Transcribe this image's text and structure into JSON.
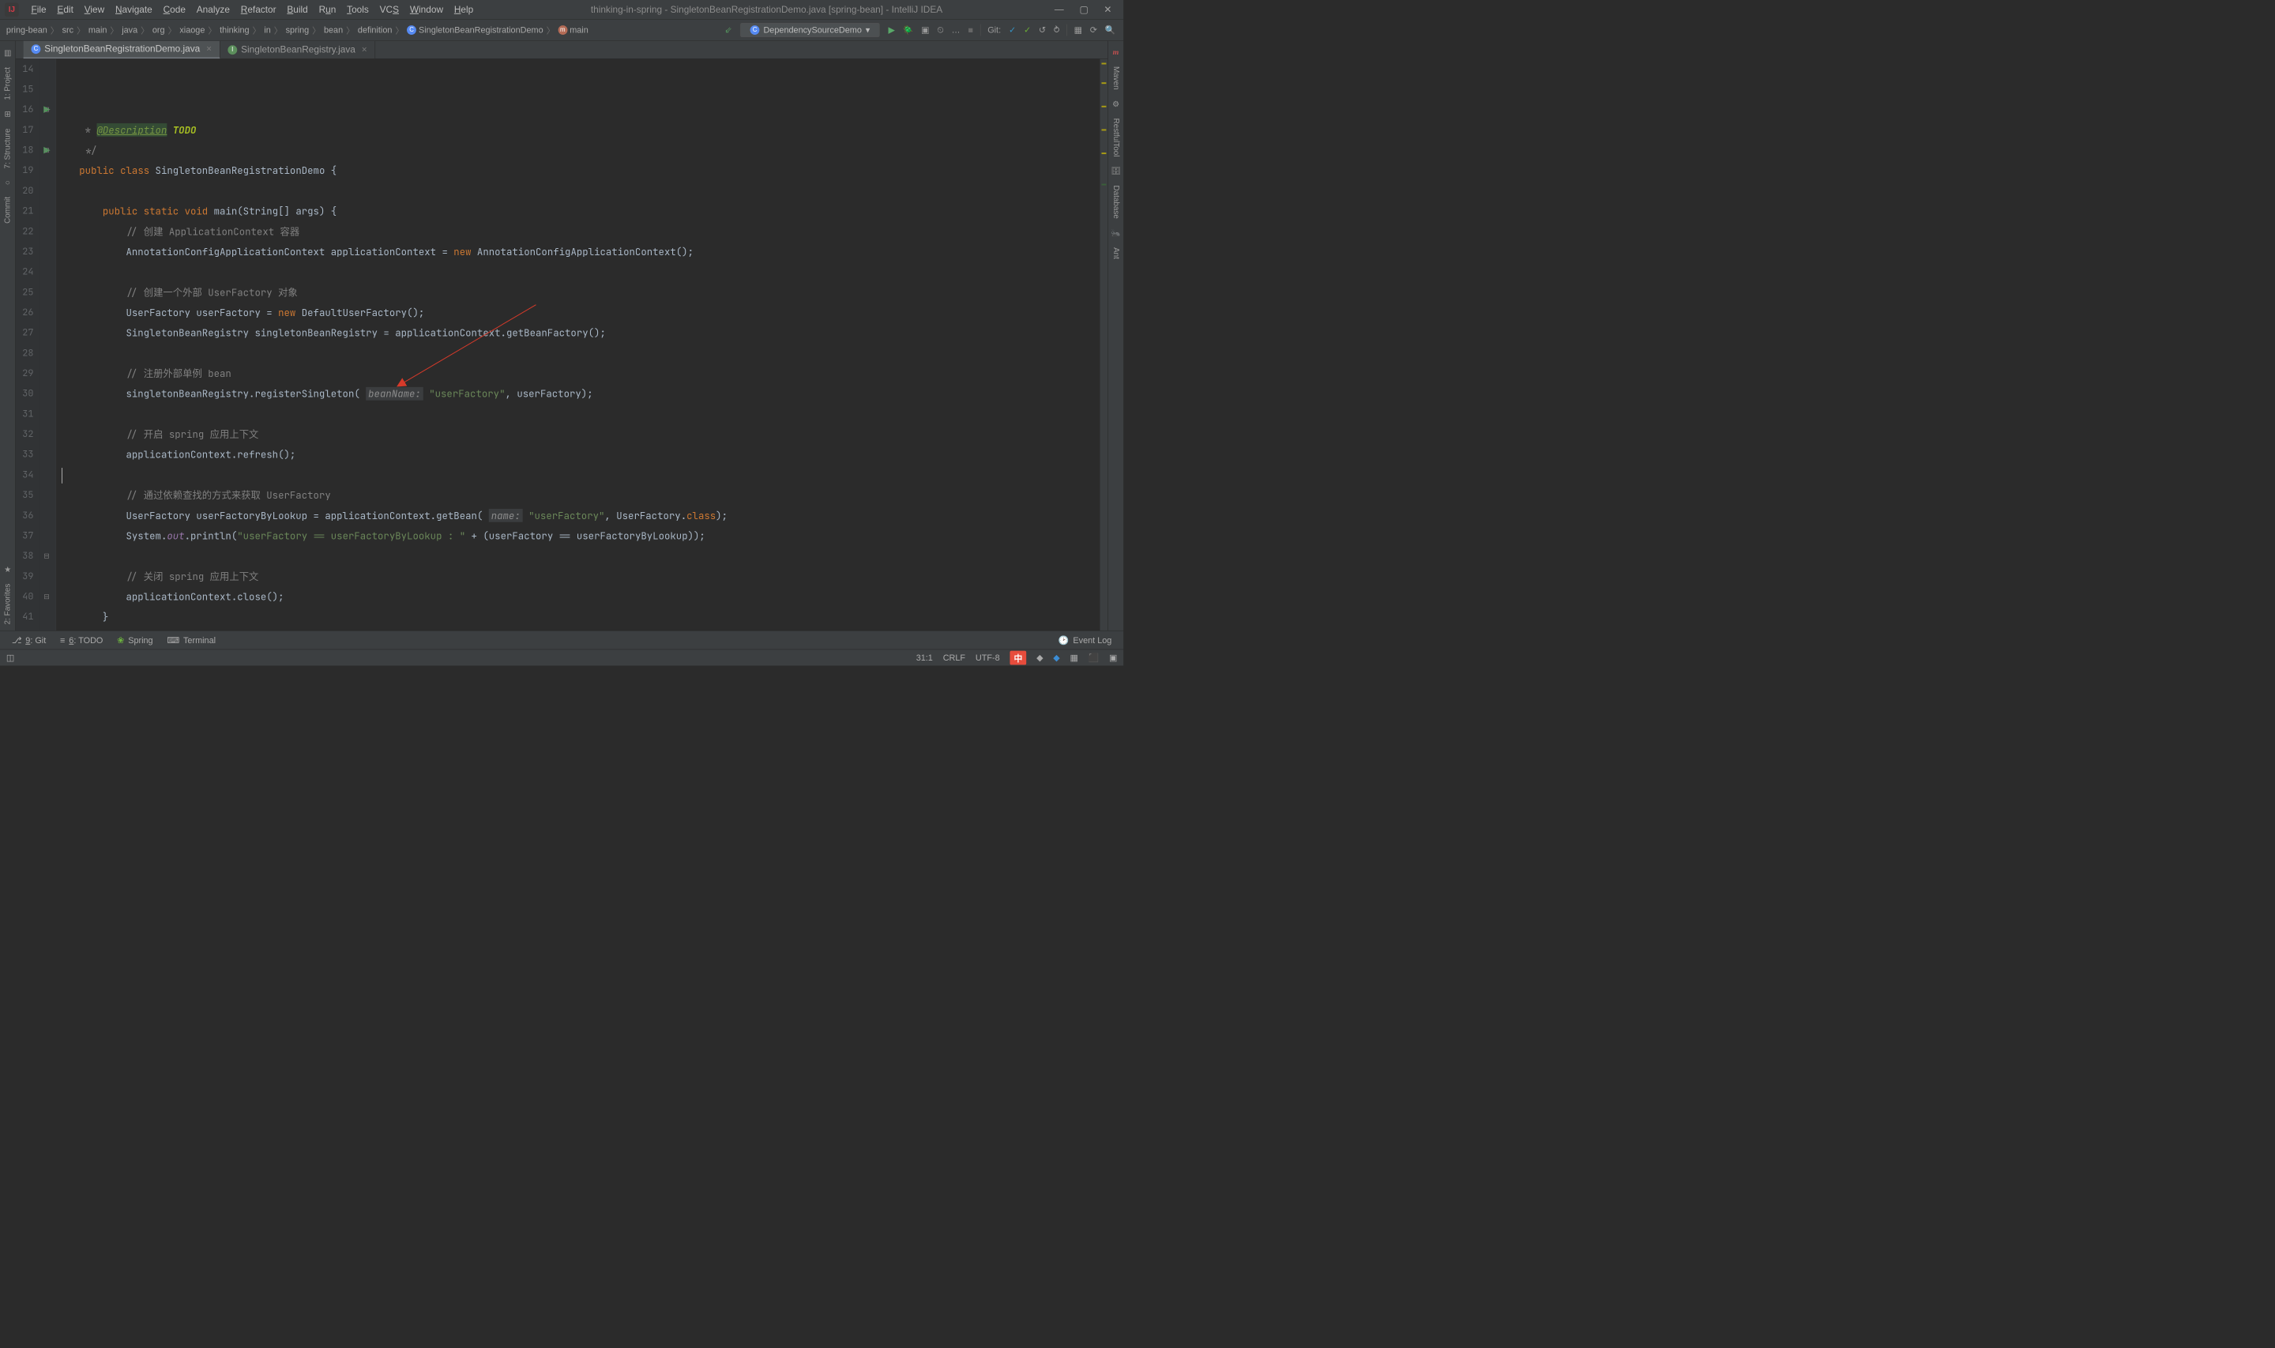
{
  "window": {
    "title": "thinking-in-spring - SingletonBeanRegistrationDemo.java [spring-bean] - IntelliJ IDEA"
  },
  "menu": {
    "file": "File",
    "edit": "Edit",
    "view": "View",
    "navigate": "Navigate",
    "code": "Code",
    "analyze": "Analyze",
    "refactor": "Refactor",
    "build": "Build",
    "run": "Run",
    "tools": "Tools",
    "vcs": "VCS",
    "window": "Window",
    "help": "Help"
  },
  "breadcrumb": [
    "pring-bean",
    "src",
    "main",
    "java",
    "org",
    "xiaoge",
    "thinking",
    "in",
    "spring",
    "bean",
    "definition",
    "SingletonBeanRegistrationDemo",
    "main"
  ],
  "runconfig": {
    "label": "DependencySourceDemo"
  },
  "git_label": "Git:",
  "tabs": {
    "t1": "SingletonBeanRegistrationDemo.java",
    "t2": "SingletonBeanRegistry.java"
  },
  "left_rail": {
    "project": "1: Project",
    "structure": "7: Structure",
    "commit": "Commit",
    "favorites": "2: Favorites"
  },
  "right_rail": {
    "maven": "Maven",
    "restful": "RestfulTool",
    "database": "Database",
    "ant": "Ant"
  },
  "code": {
    "line_start": 14,
    "cursor_line": 31,
    "lines": [
      {
        "n": 14,
        "html": "    <span class='comm'>* </span><span class='ann'>@Description</span><span class='todo'> TODO</span>"
      },
      {
        "n": 15,
        "html": "    <span class='comm'>*/</span>"
      },
      {
        "n": 16,
        "run": true,
        "fold": true,
        "html": "   <span class='kw'>public class</span> SingletonBeanRegistrationDemo {"
      },
      {
        "n": 17,
        "html": ""
      },
      {
        "n": 18,
        "run": true,
        "fold": true,
        "html": "       <span class='kw'>public static void</span> <span class='meth'>main</span>(String[] args) {"
      },
      {
        "n": 19,
        "html": "           <span class='comm'>// 创建 ApplicationContext 容器</span>"
      },
      {
        "n": 20,
        "html": "           AnnotationConfigApplicationContext applicationContext = <span class='kw'>new</span> AnnotationConfigApplicationContext();"
      },
      {
        "n": 21,
        "html": ""
      },
      {
        "n": 22,
        "html": "           <span class='comm'>// 创建一个外部 UserFactory 对象</span>"
      },
      {
        "n": 23,
        "html": "           UserFactory userFactory = <span class='kw'>new</span> DefaultUserFactory();"
      },
      {
        "n": 24,
        "html": "           SingletonBeanRegistry singletonBeanRegistry = applicationContext.getBeanFactory();"
      },
      {
        "n": 25,
        "html": ""
      },
      {
        "n": 26,
        "html": "           <span class='comm'>// 注册外部单例 bean</span>"
      },
      {
        "n": 27,
        "html": "           singletonBeanRegistry.registerSingleton( <span class='paramname'>beanName:</span> <span class='str'>\"userFactory\"</span>, userFactory);"
      },
      {
        "n": 28,
        "html": ""
      },
      {
        "n": 29,
        "html": "           <span class='comm'>// 开启 spring 应用上下文</span>"
      },
      {
        "n": 30,
        "html": "           applicationContext.refresh();"
      },
      {
        "n": 31,
        "html": "<span class='caret'></span>"
      },
      {
        "n": 32,
        "html": "           <span class='comm'>// 通过依赖查找的方式来获取 UserFactory</span>"
      },
      {
        "n": 33,
        "html": "           UserFactory userFactoryByLookup = applicationContext.getBean( <span class='paramname'>name:</span> <span class='str'>\"userFactory\"</span>, UserFactory.<span class='kw'>class</span>);"
      },
      {
        "n": 34,
        "html": "           System.<span class='field'>out</span>.println(<span class='str'>\"userFactory == userFactoryByLookup : \"</span> + (userFactory == userFactoryByLookup));"
      },
      {
        "n": 35,
        "html": ""
      },
      {
        "n": 36,
        "html": "           <span class='comm'>// 关闭 spring 应用上下文</span>"
      },
      {
        "n": 37,
        "html": "           applicationContext.close();"
      },
      {
        "n": 38,
        "fold": true,
        "html": "       }"
      },
      {
        "n": 39,
        "html": ""
      },
      {
        "n": 40,
        "fold": true,
        "html": "   }"
      },
      {
        "n": 41,
        "html": ""
      }
    ]
  },
  "toolwin": {
    "git": "9: Git",
    "todo": "6: TODO",
    "spring": "Spring",
    "terminal": "Terminal",
    "eventlog": "Event Log"
  },
  "status": {
    "pos": "31:1",
    "lineend": "CRLF",
    "enc": "UTF-8",
    "ime": "中"
  }
}
